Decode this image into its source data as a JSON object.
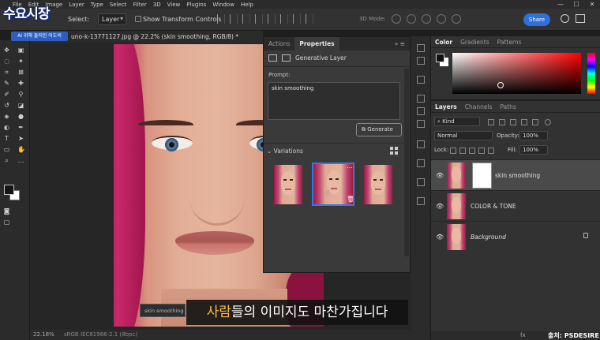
{
  "menu": [
    "File",
    "Edit",
    "Image",
    "Layer",
    "Type",
    "Select",
    "Filter",
    "3D",
    "View",
    "Plugins",
    "Window",
    "Help"
  ],
  "window_controls": [
    "—",
    "☐",
    "✕"
  ],
  "options": {
    "auto_select_label": "Select:",
    "layer_select_value": "Layer",
    "transform_label": "Show Transform Controls",
    "mode3d_label": "3D Mode:",
    "share_label": "Share"
  },
  "overlay": {
    "logo": "수요시장",
    "tag": "AI 위해 둘러헌 어도비"
  },
  "document": {
    "tab_title": "uno-k-13771127.jpg @ 22.2% (skin smoothing, RGB/8) *"
  },
  "properties": {
    "tabs": [
      "Actions",
      "Properties"
    ],
    "active_tab": "Properties",
    "layer_type": "Generative Layer",
    "prompt_label": "Prompt:",
    "prompt_value": "skin smoothing",
    "generate_label": "Generate",
    "variations_label": "Variations",
    "variation_count": 3,
    "selected_variation": 2
  },
  "color_panel": {
    "tabs": [
      "Color",
      "Gradients",
      "Patterns"
    ],
    "active_tab": "Color",
    "foreground": "#111111",
    "background": "#ffffff"
  },
  "layers_panel": {
    "tabs": [
      "Layers",
      "Channels",
      "Paths"
    ],
    "active_tab": "Layers",
    "filter_value": "Kind",
    "blend_mode": "Normal",
    "opacity_label": "Opacity:",
    "opacity_value": "100%",
    "lock_label": "Lock:",
    "fill_label": "Fill:",
    "fill_value": "100%",
    "layers": [
      {
        "name": "skin smoothing",
        "selected": true,
        "has_mask": true,
        "italic": false
      },
      {
        "name": "COLOR & TONE",
        "selected": false,
        "has_mask": false,
        "italic": false
      },
      {
        "name": "Background",
        "selected": false,
        "has_mask": false,
        "italic": true,
        "locked": true
      }
    ]
  },
  "status": {
    "zoom": "22.18%",
    "profile": "sRGB IEC61966-2.1 (8bpc)"
  },
  "bottom": {
    "fx": "fx",
    "credit": "출처: PSDESIRE"
  },
  "ghost_input": "skin smoothing",
  "subtitle": {
    "highlight": "사람",
    "rest": "들의 이미지도 마찬가집니다"
  }
}
